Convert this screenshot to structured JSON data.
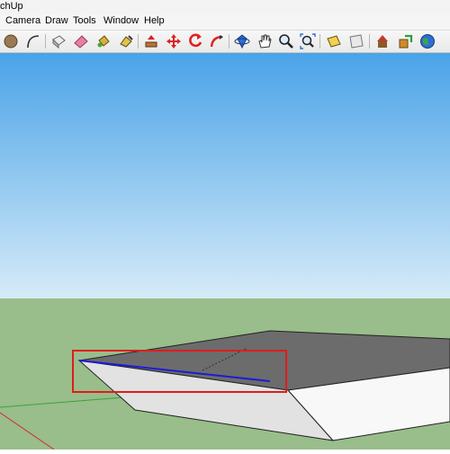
{
  "window": {
    "title": "chUp"
  },
  "menu": {
    "items": [
      "Camera",
      "Draw",
      "Tools",
      "Window",
      "Help"
    ]
  },
  "toolbar": {
    "icons": [
      "circle-icon",
      "arc-icon",
      "eraser-box-icon",
      "eraser-icon",
      "paint-bucket-icon",
      "paint-icon",
      "push-pull-icon",
      "move-icon",
      "rotate-icon",
      "follow-me-icon",
      "orbit-icon",
      "pan-icon",
      "zoom-icon",
      "zoom-extents-icon",
      "section-icon",
      "plane-icon",
      "get-models-icon",
      "share-model-icon",
      "globe-icon"
    ]
  },
  "scene": {
    "sky_top": "#4aa3e8",
    "sky_bottom": "#d6ebf8",
    "ground": "#99bd8b",
    "selection_color": "#e01b1b",
    "edge_highlight": "#1b1bd6"
  }
}
